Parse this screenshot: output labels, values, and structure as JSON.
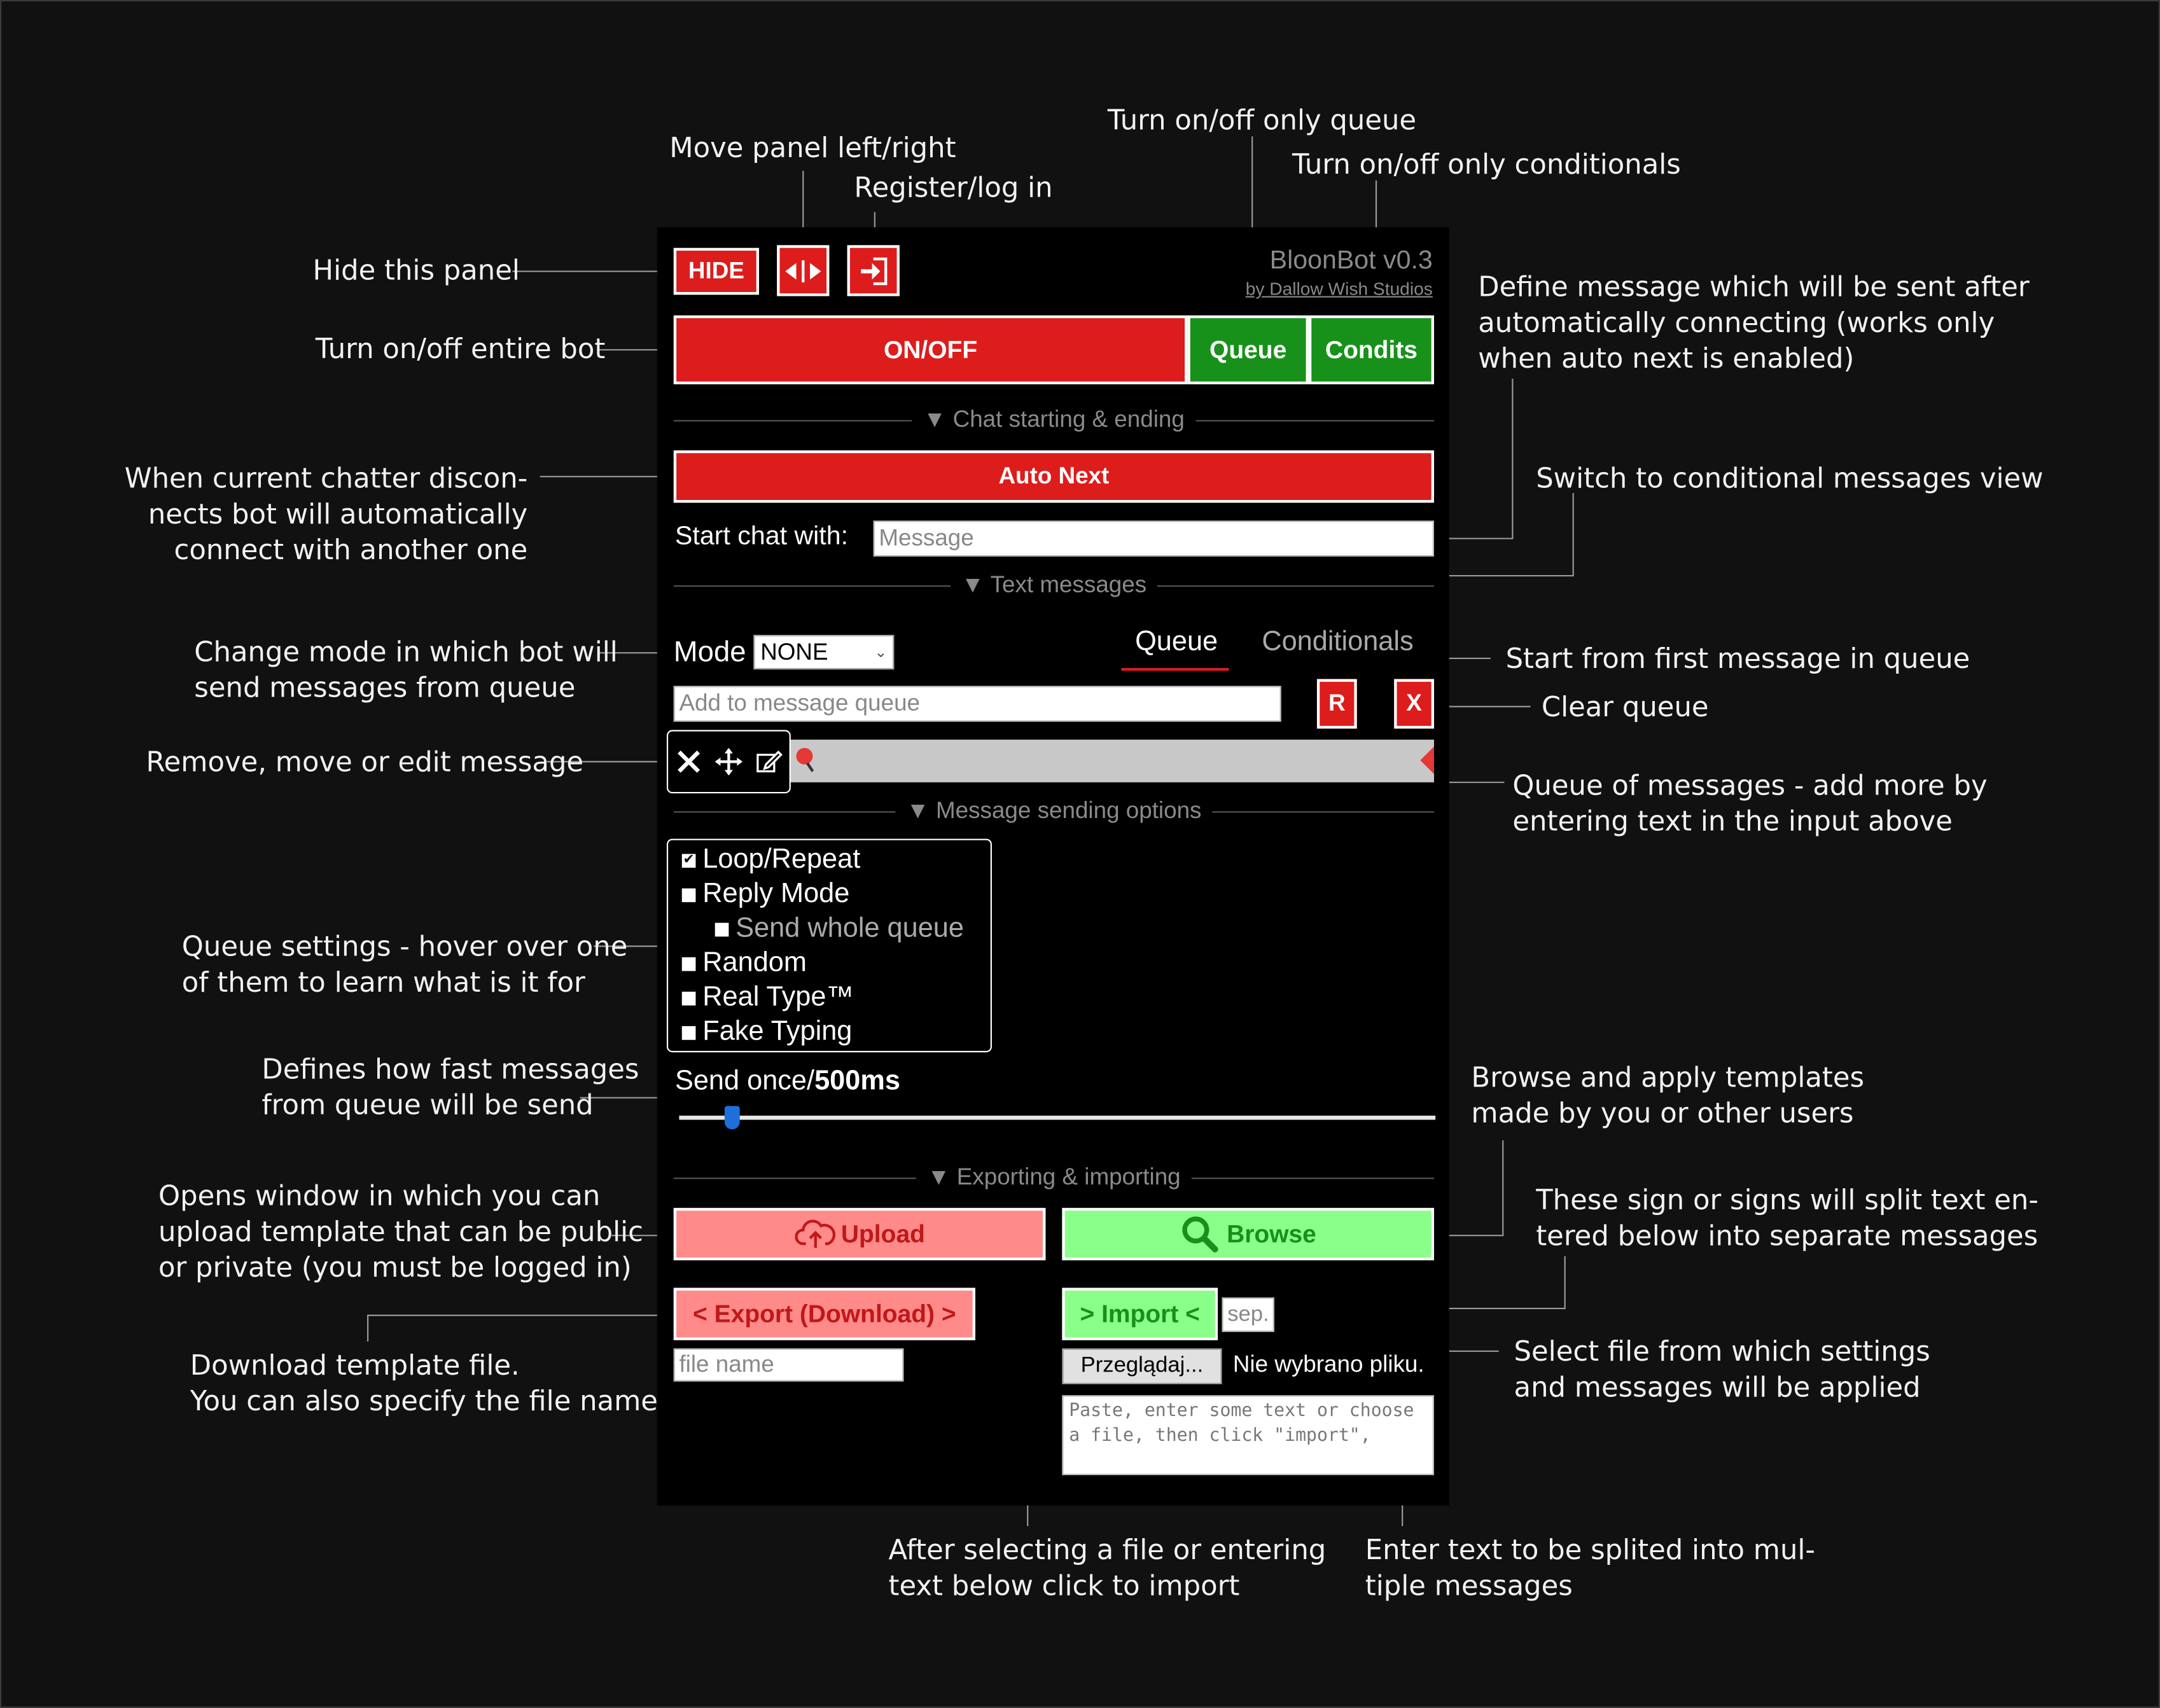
{
  "panel": {
    "hide_label": "HIDE",
    "app_name": "BloonBot v0.3",
    "author": "by Dallow Wish Studios",
    "onoff_label": "ON/OFF",
    "queue_label": "Queue",
    "condits_label": "Condits",
    "section_chat": "Chat starting & ending",
    "auto_next_label": "Auto Next",
    "start_chat_label": "Start chat with:",
    "start_chat_placeholder": "Message",
    "section_text": "Text messages",
    "mode_label": "Mode",
    "mode_value": "NONE",
    "tab_queue": "Queue",
    "tab_conditionals": "Conditionals",
    "queue_input_placeholder": "Add to message queue",
    "reset_label": "R",
    "clear_label": "X",
    "section_sending": "Message sending options",
    "options": [
      {
        "label": "Loop/Repeat",
        "checked": true
      },
      {
        "label": "Reply Mode",
        "checked": false
      },
      {
        "label": "Send whole queue",
        "checked": false,
        "disabled": true
      },
      {
        "label": "Random",
        "checked": false
      },
      {
        "label": "Real Type™",
        "checked": false
      },
      {
        "label": "Fake Typing",
        "checked": false
      }
    ],
    "send_prefix": "Send once/",
    "send_interval": "500ms",
    "slider_level": 0.06,
    "section_export": "Exporting & importing",
    "upload_label": "Upload",
    "browse_label": "Browse",
    "export_label": "< Export (Download) >",
    "import_label": "> Import <",
    "sep_placeholder": "sep.",
    "filename_placeholder": "file name",
    "file_button": "Przeglądaj...",
    "file_status": "Nie wybrano pliku.",
    "import_textarea_placeholder": "Paste, enter some text or choose a file, then click \"import\","
  },
  "annotations": {
    "hide": "Hide this panel",
    "move": "Move panel left/right",
    "register": "Register/log in",
    "queue_toggle": "Turn on/off only queue",
    "condits_toggle": "Turn on/off only conditionals",
    "onoff": "Turn on/off entire bot",
    "define_1": "Define message which will be sent after",
    "define_2": "automatically connecting (works only",
    "define_3": "when auto next is enabled)",
    "autonext_1": "When current chatter discon-",
    "autonext_2": "nects bot will automatically",
    "autonext_3": "connect with another one",
    "switch_cond": "Switch to conditional messages view",
    "mode_1": "Change mode in which bot will",
    "mode_2": "send messages from queue",
    "start_first": "Start from first message in queue",
    "clear_queue": "Clear queue",
    "remove_move": "Remove, move or edit message",
    "queue_of_1": "Queue of messages - add more by",
    "queue_of_2": "entering text in the input above",
    "settings_1": "Queue settings - hover over one",
    "settings_2": "of them to learn what is it for",
    "speed_1": "Defines how fast messages",
    "speed_2": "from queue will be send",
    "browse_1": "Browse and apply templates",
    "browse_2": "made by you or other users",
    "upload_1": "Opens window in which you can",
    "upload_2": "upload template that can be public",
    "upload_3": "or private (you must be logged in)",
    "sign_1": "These sign or signs will split text en-",
    "sign_2": "tered below into separate messages",
    "download_1": "Download template file.",
    "download_2": "You can also specify the file name",
    "select_1": "Select file from which settings",
    "select_2": "and messages will be applied",
    "import_1": "After selecting a file or entering",
    "import_2": "text below click to import",
    "enter_1": "Enter text to be splited into mul-",
    "enter_2": "tiple messages"
  }
}
